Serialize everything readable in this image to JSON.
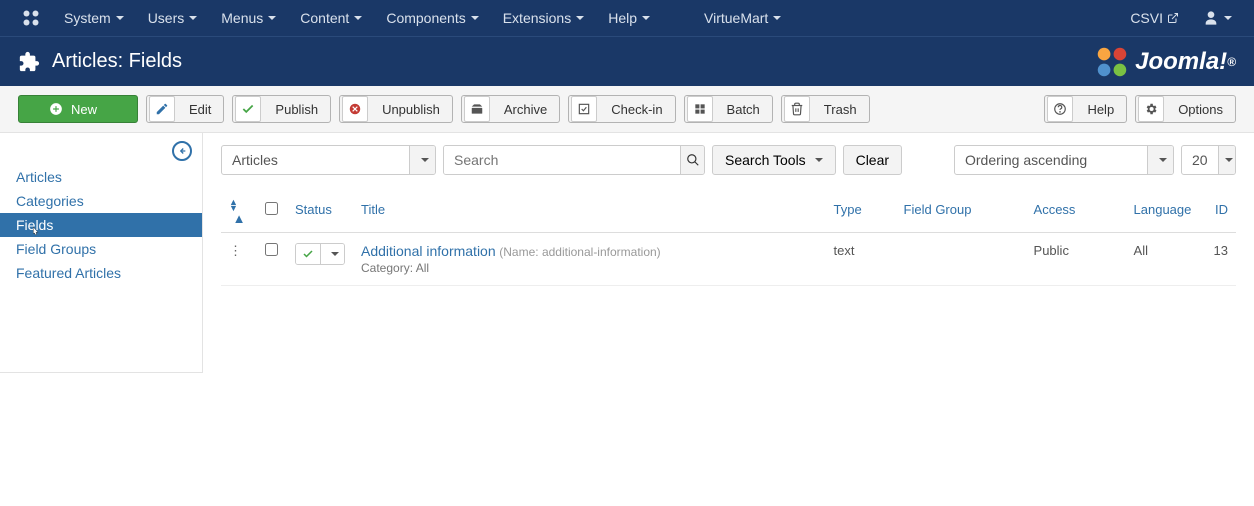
{
  "topnav": {
    "left": [
      "System",
      "Users",
      "Menus",
      "Content",
      "Components",
      "Extensions",
      "Help"
    ],
    "virtuemart": "VirtueMart",
    "csvi": "CSVI"
  },
  "header": {
    "title": "Articles: Fields",
    "brand": "Joomla!"
  },
  "toolbar": {
    "new": "New",
    "edit": "Edit",
    "publish": "Publish",
    "unpublish": "Unpublish",
    "archive": "Archive",
    "checkin": "Check-in",
    "batch": "Batch",
    "trash": "Trash",
    "help": "Help",
    "options": "Options"
  },
  "sidebar": {
    "items": [
      "Articles",
      "Categories",
      "Fields",
      "Field Groups",
      "Featured Articles"
    ],
    "active_index": 2
  },
  "filters": {
    "context": "Articles",
    "search_placeholder": "Search",
    "search_tools": "Search Tools",
    "clear": "Clear",
    "ordering": "Ordering ascending",
    "limit": "20"
  },
  "table": {
    "headers": {
      "status": "Status",
      "title": "Title",
      "type": "Type",
      "field_group": "Field Group",
      "access": "Access",
      "language": "Language",
      "id": "ID"
    },
    "rows": [
      {
        "title": "Additional information",
        "name_label": "(Name: additional-information)",
        "category_label": "Category: All",
        "type": "text",
        "field_group": "",
        "access": "Public",
        "language": "All",
        "id": "13"
      }
    ]
  }
}
